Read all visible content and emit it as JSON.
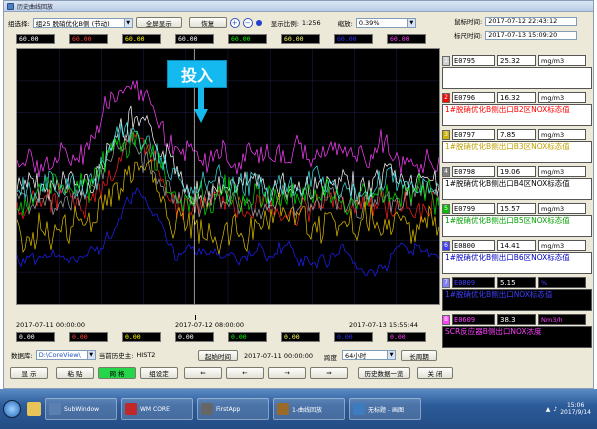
{
  "window": {
    "title": "历史曲线回放"
  },
  "toolbar": {
    "group_label": "组选择:",
    "group_value": "组25 脱硝优化B侧 (节动)",
    "fullscreen": "全屏显示",
    "restore": "恢复",
    "display_ratio_label": "显示比例:",
    "display_ratio_value": "1:256",
    "zoom_label": "缩放:",
    "zoom_value": "0.39%",
    "cursor_time_label": "鼠标时间:",
    "cursor_time_value": "2017-07-12 22:43:12",
    "ruler_time_label": "标尺时间:",
    "ruler_time_value": "2017-07-13 15:09:20"
  },
  "top_values": [
    {
      "value": "60.00",
      "color": "#ffffff"
    },
    {
      "value": "60.00",
      "color": "#ff4040"
    },
    {
      "value": "60.00",
      "color": "#ffff00"
    },
    {
      "value": "60.00",
      "color": "#ffffff"
    },
    {
      "value": "60.00",
      "color": "#00ff00"
    },
    {
      "value": "60.00",
      "color": "#ffff66"
    },
    {
      "value": "60.00",
      "color": "#3030ff"
    },
    {
      "value": "60.00",
      "color": "#ff40ff"
    }
  ],
  "bottom_values": [
    {
      "value": "0.00",
      "color": "#ffffff"
    },
    {
      "value": "0.00",
      "color": "#ff4040"
    },
    {
      "value": "0.00",
      "color": "#ffff00"
    },
    {
      "value": "0.00",
      "color": "#ffffff"
    },
    {
      "value": "0.00",
      "color": "#00ff00"
    },
    {
      "value": "0.00",
      "color": "#ffff66"
    },
    {
      "value": "0.00",
      "color": "#3030ff"
    },
    {
      "value": "0.00",
      "color": "#ff40ff"
    }
  ],
  "time_axis": {
    "start": "2017-07-11 00:00:00",
    "mid": "2017-07-12 08:00:00",
    "end": "2017-07-13 15:55:44",
    "second": "2017-07-11 00:00:00"
  },
  "annotation": "投入",
  "legend": [
    {
      "num": "1",
      "code": "E0795",
      "value": "25.32",
      "unit": "mg/m3",
      "desc": "1#脱硝优化B侧出口B1区NOX标态值",
      "color": "#ffffff",
      "numbg": "#d0d0d0"
    },
    {
      "num": "2",
      "code": "E0796",
      "value": "16.32",
      "unit": "mg/m3",
      "desc": "1#脱硝优化B侧出口B2区NOX标态值",
      "color": "#ff0000",
      "numbg": "#ff0000"
    },
    {
      "num": "3",
      "code": "E0797",
      "value": "7.85",
      "unit": "mg/m3",
      "desc": "1#脱硝优化B侧出口B3区NOX标态值",
      "color": "#c0a000",
      "numbg": "#d0b000"
    },
    {
      "num": "4",
      "code": "E0798",
      "value": "19.06",
      "unit": "mg/m3",
      "desc": "1#脱硝优化B侧出口B4区NOX标态值",
      "color": "#000000",
      "numbg": "#808080"
    },
    {
      "num": "5",
      "code": "E0799",
      "value": "15.57",
      "unit": "mg/m3",
      "desc": "1#脱硝优化B侧出口B5区NOX标态值",
      "color": "#00a000",
      "numbg": "#00c000"
    },
    {
      "num": "6",
      "code": "E0800",
      "value": "14.41",
      "unit": "mg/m3",
      "desc": "1#脱硝优化B侧出口B6区NOX标态值",
      "color": "#0000c0",
      "numbg": "#4040ff"
    },
    {
      "num": "7",
      "code": "E0809",
      "value": "5.15",
      "unit": "%",
      "desc": "1#脱硝优化B侧出口NOX标态值",
      "color": "#4040ff",
      "numbg": "#8080ff"
    },
    {
      "num": "8",
      "code": "E0609",
      "value": "38.3",
      "unit": "Nm3/h",
      "desc": "SCR反应器B侧出口NOX浓度",
      "color": "#ff40ff",
      "numbg": "#ff40ff"
    }
  ],
  "bottom_bar": {
    "db_label": "数据库:",
    "db_value": "D:\\CoreView\\",
    "history_label": "当前历史主:",
    "history_value": "HIST2",
    "start_time_btn": "起始时间",
    "start_time_value": "2017-07-11 00:00:00",
    "span_label": "跨度",
    "span_value": "64小时",
    "long_period_btn": "长周期"
  },
  "action_bar": {
    "display": "显 示",
    "paste": "粘 贴",
    "grid": "网 格",
    "group_set": "组设定",
    "history_list": "历史数据一览",
    "close": "关 闭"
  },
  "taskbar": {
    "items": [
      {
        "label": "SubWindow",
        "color": "#5a7fb0"
      },
      {
        "label": "WM CORE",
        "color": "#c0282a"
      },
      {
        "label": "FirstApp",
        "color": "#666"
      },
      {
        "label": "1-曲线回放",
        "color": "#9a6a2a"
      },
      {
        "label": "无标题 - 画图",
        "color": "#3d7cc0"
      }
    ],
    "time": "15:06",
    "date": "2017/9/14"
  }
}
